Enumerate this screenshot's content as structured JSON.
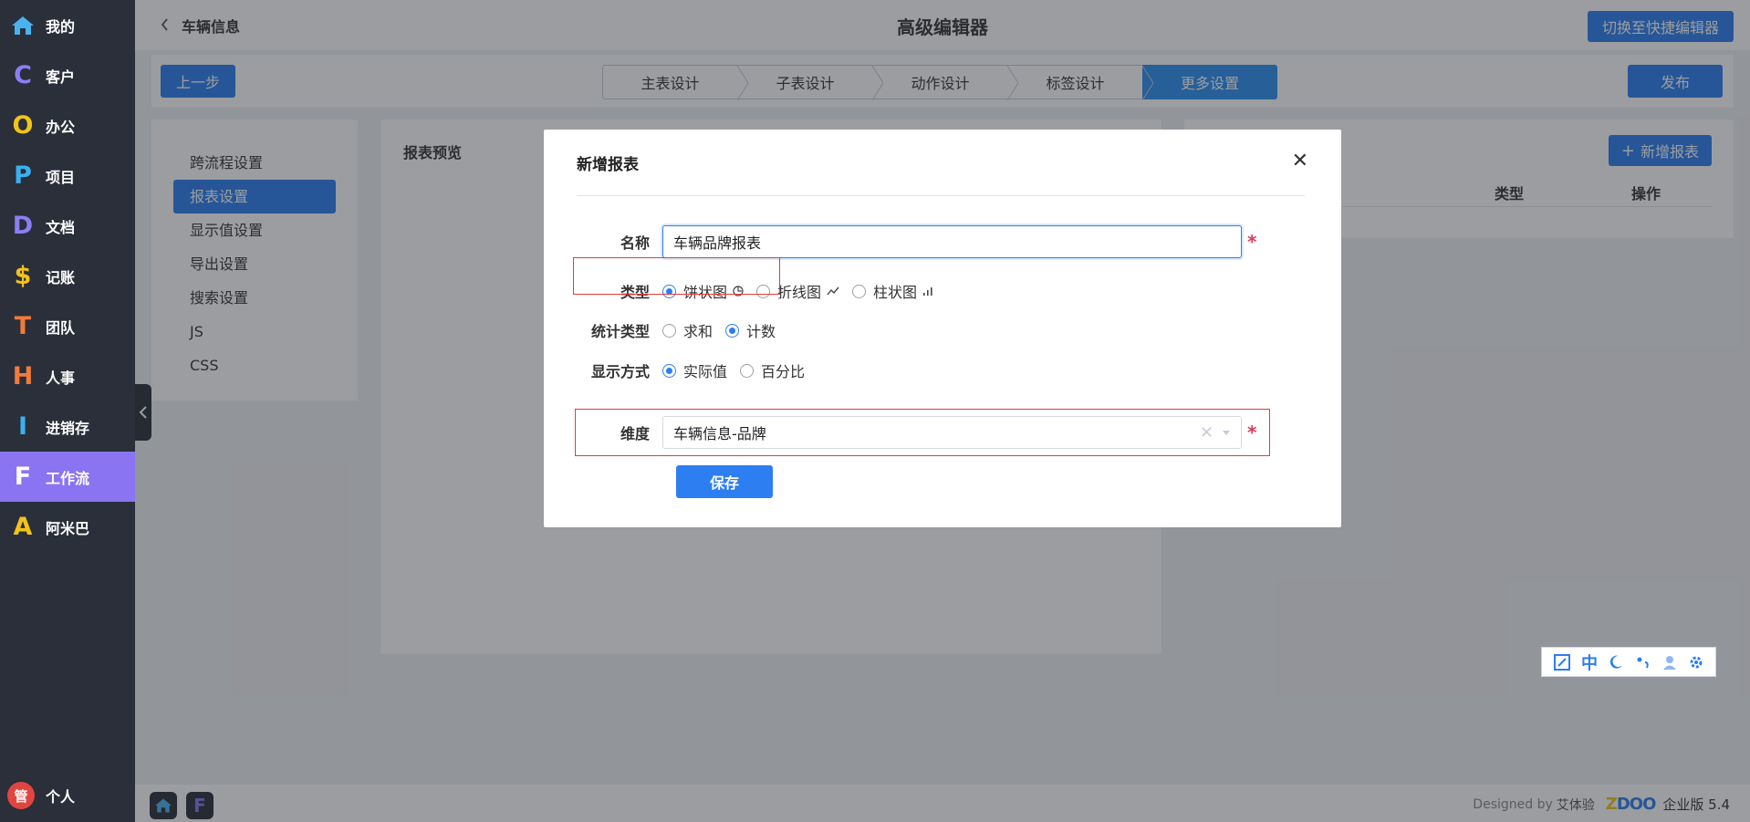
{
  "nav": {
    "items": [
      {
        "letter": "",
        "label": "我的",
        "icon": "home-icon",
        "color": "#4ab3ef"
      },
      {
        "letter": "C",
        "label": "客户",
        "color": "#8b7ef5"
      },
      {
        "letter": "O",
        "label": "办公",
        "color": "#f3c31a"
      },
      {
        "letter": "P",
        "label": "项目",
        "color": "#3ab0ef"
      },
      {
        "letter": "D",
        "label": "文档",
        "color": "#8b7ef5"
      },
      {
        "letter": "$",
        "label": "记账",
        "color": "#f3c31a"
      },
      {
        "letter": "T",
        "label": "团队",
        "color": "#f47a3a"
      },
      {
        "letter": "H",
        "label": "人事",
        "color": "#f47a3a"
      },
      {
        "letter": "I",
        "label": "进销存",
        "color": "#3ab0ef"
      },
      {
        "letter": "F",
        "label": "工作流",
        "color": "#ffffff"
      },
      {
        "letter": "A",
        "label": "阿米巴",
        "color": "#f3c31a"
      }
    ],
    "user": {
      "avatar": "管",
      "label": "个人"
    }
  },
  "header": {
    "back_label": "车辆信息",
    "title": "高级编辑器",
    "switch_label": "切换至快捷编辑器"
  },
  "stepbar": {
    "prev_label": "上一步",
    "publish_label": "发布",
    "steps": [
      "主表设计",
      "子表设计",
      "动作设计",
      "标签设计",
      "更多设置"
    ]
  },
  "sidemenu": {
    "items": [
      "跨流程设置",
      "报表设置",
      "显示值设置",
      "导出设置",
      "搜索设置",
      "JS",
      "CSS"
    ]
  },
  "preview": {
    "title": "报表预览"
  },
  "reports": {
    "add_label": "新增报表",
    "col_type": "类型",
    "col_op": "操作"
  },
  "modal": {
    "title": "新增报表",
    "name_label": "名称",
    "name_value": "车辆品牌报表",
    "type_label": "类型",
    "type_options": [
      "饼状图",
      "折线图",
      "柱状图"
    ],
    "stat_label": "统计类型",
    "stat_options": [
      "求和",
      "计数"
    ],
    "display_label": "显示方式",
    "display_options": [
      "实际值",
      "百分比"
    ],
    "dimension_label": "维度",
    "dimension_value": "车辆信息-品牌",
    "save_label": "保存"
  },
  "footer": {
    "designed_by": "Designed by",
    "designer": "艾体验",
    "zdoo_z": "Z",
    "zdoo_rest": "DOO",
    "version": "企业版 5.4"
  }
}
